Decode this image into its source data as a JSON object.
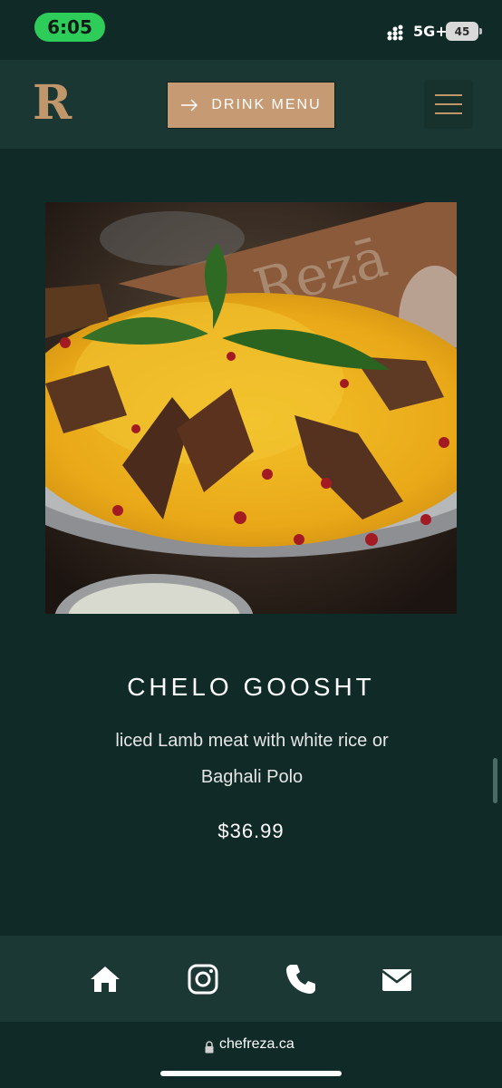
{
  "status": {
    "time": "6:05",
    "network": "5G+",
    "battery": "45"
  },
  "header": {
    "logo_letter": "R",
    "drink_menu_label": "DRINK MENU"
  },
  "dish": {
    "name": "CHELO GOOSHT",
    "description_line1": "liced Lamb meat with white rice or",
    "description_line2": "Baghali Polo",
    "price": "$36.99"
  },
  "bottom_nav": {
    "icons": [
      "home-icon",
      "instagram-icon",
      "phone-icon",
      "mail-icon"
    ]
  },
  "browser": {
    "url": "chefreza.ca"
  },
  "colors": {
    "background": "#0f2a27",
    "header": "#1b3733",
    "accent": "#c69b74"
  }
}
